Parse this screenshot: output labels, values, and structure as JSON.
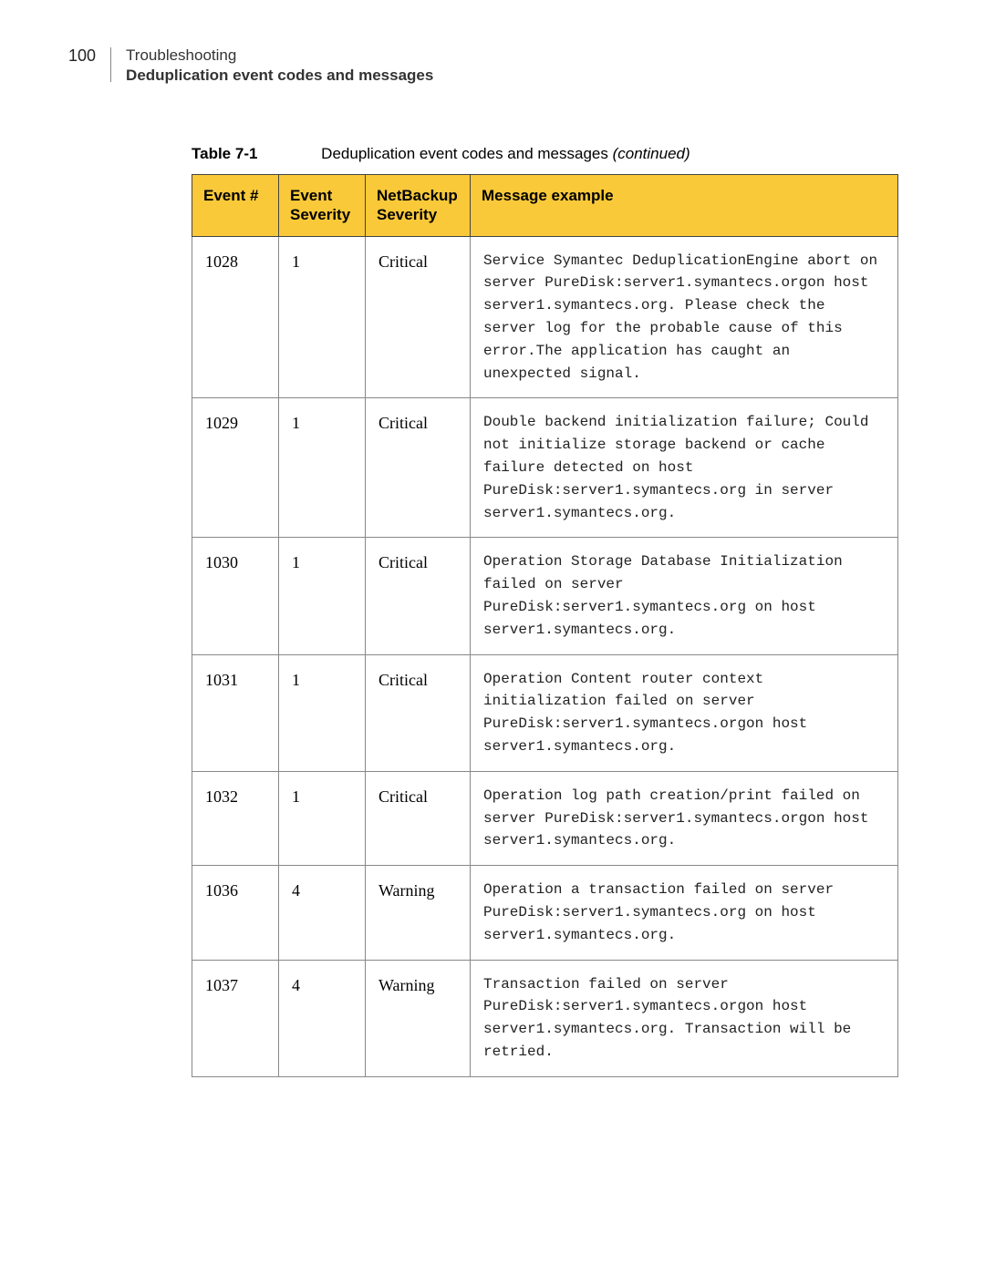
{
  "header": {
    "page_number": "100",
    "line1": "Troubleshooting",
    "line2": "Deduplication event codes and messages"
  },
  "table": {
    "caption_label": "Table 7-1",
    "caption_text": "Deduplication event codes and messages (continued)",
    "caption_italic": "(continued)",
    "headers": {
      "event": "Event #",
      "ev_sev": "Event Severity",
      "nb_sev": "NetBackup Severity",
      "msg": "Message example"
    },
    "rows": [
      {
        "event": "1028",
        "ev_sev": "1",
        "nb_sev": "Critical",
        "msg": "Service Symantec DeduplicationEngine abort on server PureDisk:server1.symantecs.orgon host server1.symantecs.org. Please check the server log for the probable cause of this error.The application has caught an unexpected signal."
      },
      {
        "event": "1029",
        "ev_sev": "1",
        "nb_sev": "Critical",
        "msg": "Double backend initialization failure; Could not initialize storage backend or cache failure detected on host PureDisk:server1.symantecs.org in server server1.symantecs.org."
      },
      {
        "event": "1030",
        "ev_sev": "1",
        "nb_sev": "Critical",
        "msg": "Operation Storage Database Initialization failed on server PureDisk:server1.symantecs.org on host server1.symantecs.org."
      },
      {
        "event": "1031",
        "ev_sev": "1",
        "nb_sev": "Critical",
        "msg": "Operation Content router context initialization failed on server PureDisk:server1.symantecs.orgon host server1.symantecs.org."
      },
      {
        "event": "1032",
        "ev_sev": "1",
        "nb_sev": "Critical",
        "msg": "Operation log path creation/print failed on server PureDisk:server1.symantecs.orgon host server1.symantecs.org."
      },
      {
        "event": "1036",
        "ev_sev": "4",
        "nb_sev": "Warning",
        "msg": "Operation a transaction failed on server PureDisk:server1.symantecs.org on host server1.symantecs.org."
      },
      {
        "event": "1037",
        "ev_sev": "4",
        "nb_sev": "Warning",
        "msg": "Transaction failed on server PureDisk:server1.symantecs.orgon host server1.symantecs.org. Transaction will be retried."
      }
    ]
  }
}
